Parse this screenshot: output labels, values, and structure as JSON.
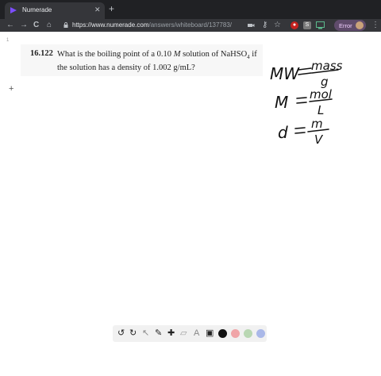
{
  "browser": {
    "tab_title": "Numerade",
    "tab_close": "✕",
    "new_tab": "+",
    "url_host": "https://www.numerade.com",
    "url_path": "/answers/whiteboard/137783/",
    "error_label": "Error",
    "extension_s": "S"
  },
  "icons": {
    "back": "←",
    "forward": "→",
    "reload": "C",
    "home": "⌂",
    "star": "☆",
    "menu": "⋮"
  },
  "problem": {
    "number": "16.122",
    "text_prefix": "What is the boiling point of a 0.10 ",
    "molarity_unit": "M",
    "text_mid": " solution of NaHSO",
    "subscript": "4",
    "text_suffix": " if the solution has a density of 1.002 g/mL?"
  },
  "handwriting": {
    "line1_left": "MW",
    "line1_num": "mass",
    "line1_den": "g",
    "line2_left": "M",
    "line2_num": "mol",
    "line2_den": "L",
    "line3_left": "d",
    "line3_num": "m",
    "line3_den": "V"
  },
  "canvas": {
    "page_marker": "1",
    "crosshair": "+"
  },
  "tools": {
    "undo": "↺",
    "redo": "↻",
    "select": "↖",
    "pen": "✎",
    "add": "✚",
    "eraser": "▱",
    "text": "A",
    "image": "▣"
  },
  "colors": {
    "black": "#111111",
    "pink": "#f0a5a8",
    "green": "#b9d7b3",
    "blue": "#aab8e8",
    "accent": "#7c4dff"
  }
}
